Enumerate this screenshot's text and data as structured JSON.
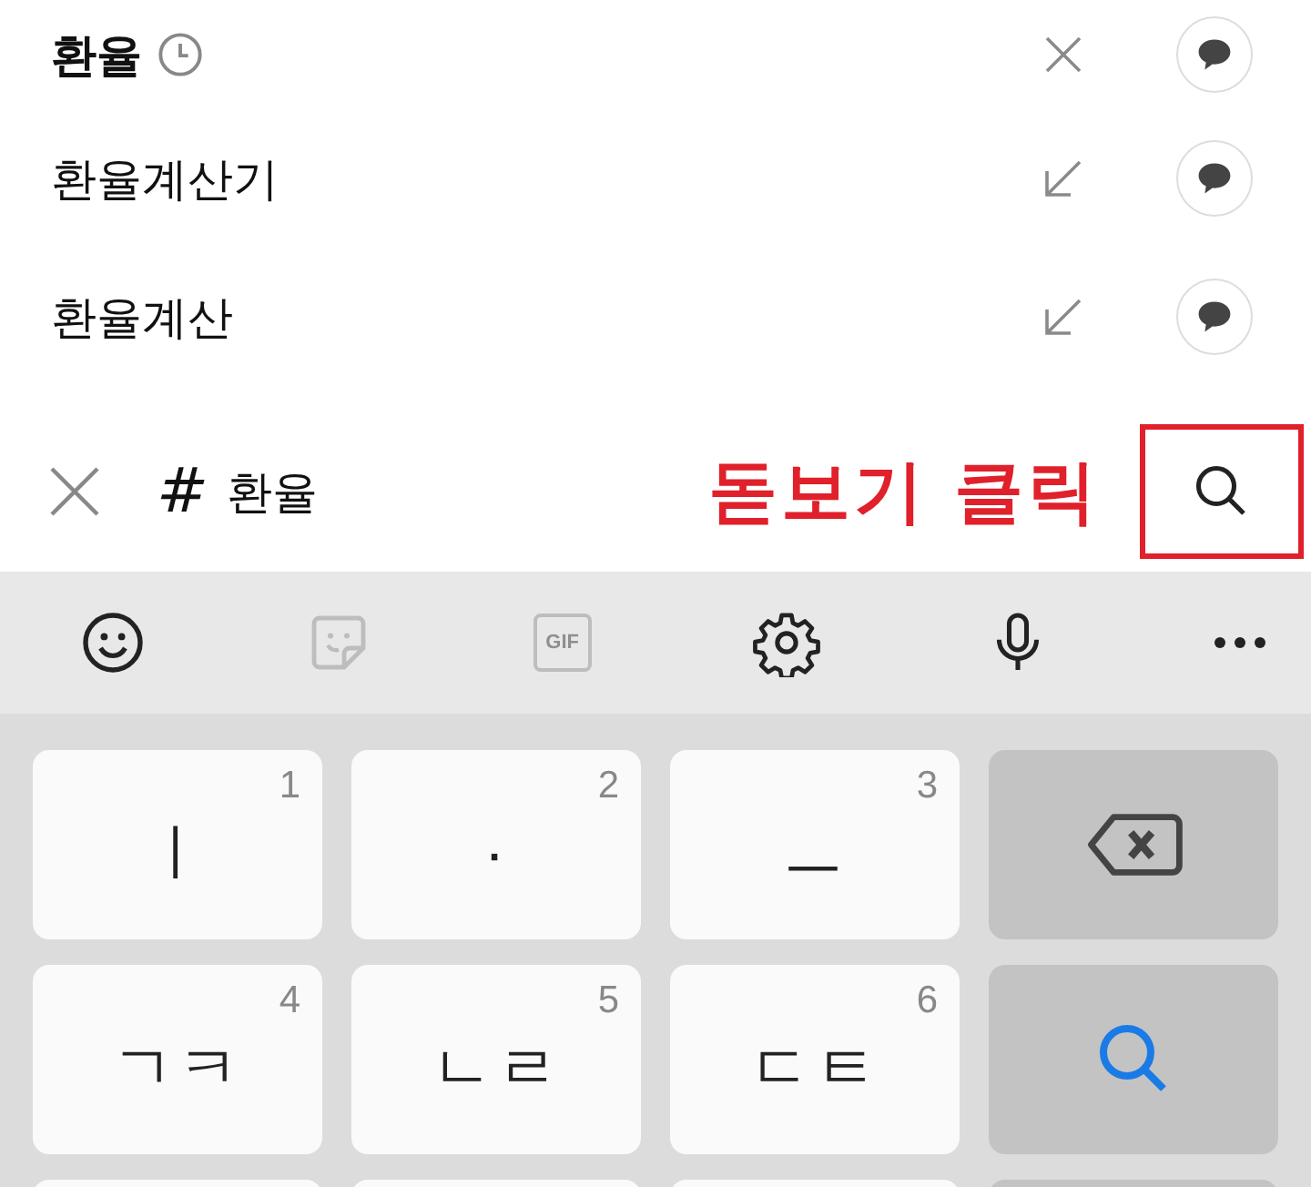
{
  "suggestions": [
    {
      "text": "환율",
      "kind": "recent"
    },
    {
      "text": "환율계산기",
      "kind": "suggestion"
    },
    {
      "text": "환율계산",
      "kind": "suggestion"
    }
  ],
  "search_bar": {
    "hash": "#",
    "value": "환율",
    "annotation": "돋보기 클릭",
    "search_highlighted": true
  },
  "toolbar": [
    {
      "kind": "emoji",
      "disabled": false
    },
    {
      "kind": "sticker",
      "disabled": true
    },
    {
      "kind": "gif",
      "label": "GIF",
      "disabled": true
    },
    {
      "kind": "settings",
      "disabled": false
    },
    {
      "kind": "mic",
      "disabled": false
    },
    {
      "kind": "more",
      "disabled": false
    }
  ],
  "keys": [
    {
      "kind": "char",
      "label": "ㅣ",
      "number": "1"
    },
    {
      "kind": "char",
      "label": "·",
      "number": "2"
    },
    {
      "kind": "char",
      "label": "ㅡ",
      "number": "3"
    },
    {
      "kind": "backspace"
    },
    {
      "kind": "char",
      "label": "ㄱㅋ",
      "number": "4"
    },
    {
      "kind": "char",
      "label": "ㄴㄹ",
      "number": "5"
    },
    {
      "kind": "char",
      "label": "ㄷㅌ",
      "number": "6"
    },
    {
      "kind": "search"
    }
  ]
}
